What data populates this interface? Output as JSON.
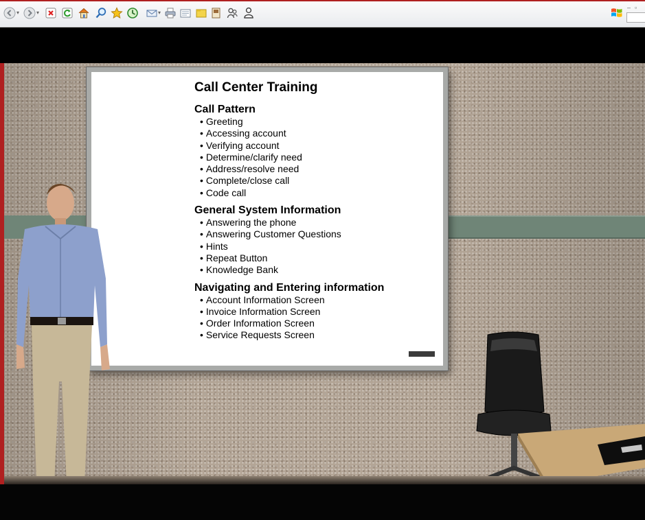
{
  "toolbar": {
    "buttons": [
      {
        "icon": "back-icon"
      },
      {
        "icon": "forward-icon"
      },
      {
        "icon": "stop-icon"
      },
      {
        "icon": "refresh-icon"
      },
      {
        "icon": "home-icon"
      },
      {
        "icon": "search-icon"
      },
      {
        "icon": "favorites-star-icon"
      },
      {
        "icon": "history-icon"
      },
      {
        "icon": "mail-icon"
      },
      {
        "icon": "print-icon"
      },
      {
        "icon": "edit-icon"
      },
      {
        "icon": "folder-icon"
      },
      {
        "icon": "research-icon"
      },
      {
        "icon": "messenger-icon"
      },
      {
        "icon": "user-icon"
      }
    ],
    "window_logo_icon": "windows-flag-icon"
  },
  "whiteboard": {
    "title": "Call Center Training",
    "sections": [
      {
        "heading": "Call Pattern",
        "items": [
          "Greeting",
          "Accessing account",
          "Verifying account",
          "Determine/clarify need",
          "Address/resolve need",
          "Complete/close call",
          "Code call"
        ]
      },
      {
        "heading": "General System Information",
        "items": [
          "Answering the phone",
          "Answering Customer Questions",
          "Hints",
          "Repeat Button",
          "Knowledge Bank"
        ]
      },
      {
        "heading": "Navigating and Entering information",
        "items": [
          "Account Information Screen",
          "Invoice Information Screen",
          "Order Information Screen",
          "Service Requests Screen"
        ]
      }
    ]
  },
  "colors": {
    "frame_accent": "#b02020",
    "wall": "#b3a596",
    "rail": "#6f8577",
    "board_frame": "#a8aaa8"
  }
}
